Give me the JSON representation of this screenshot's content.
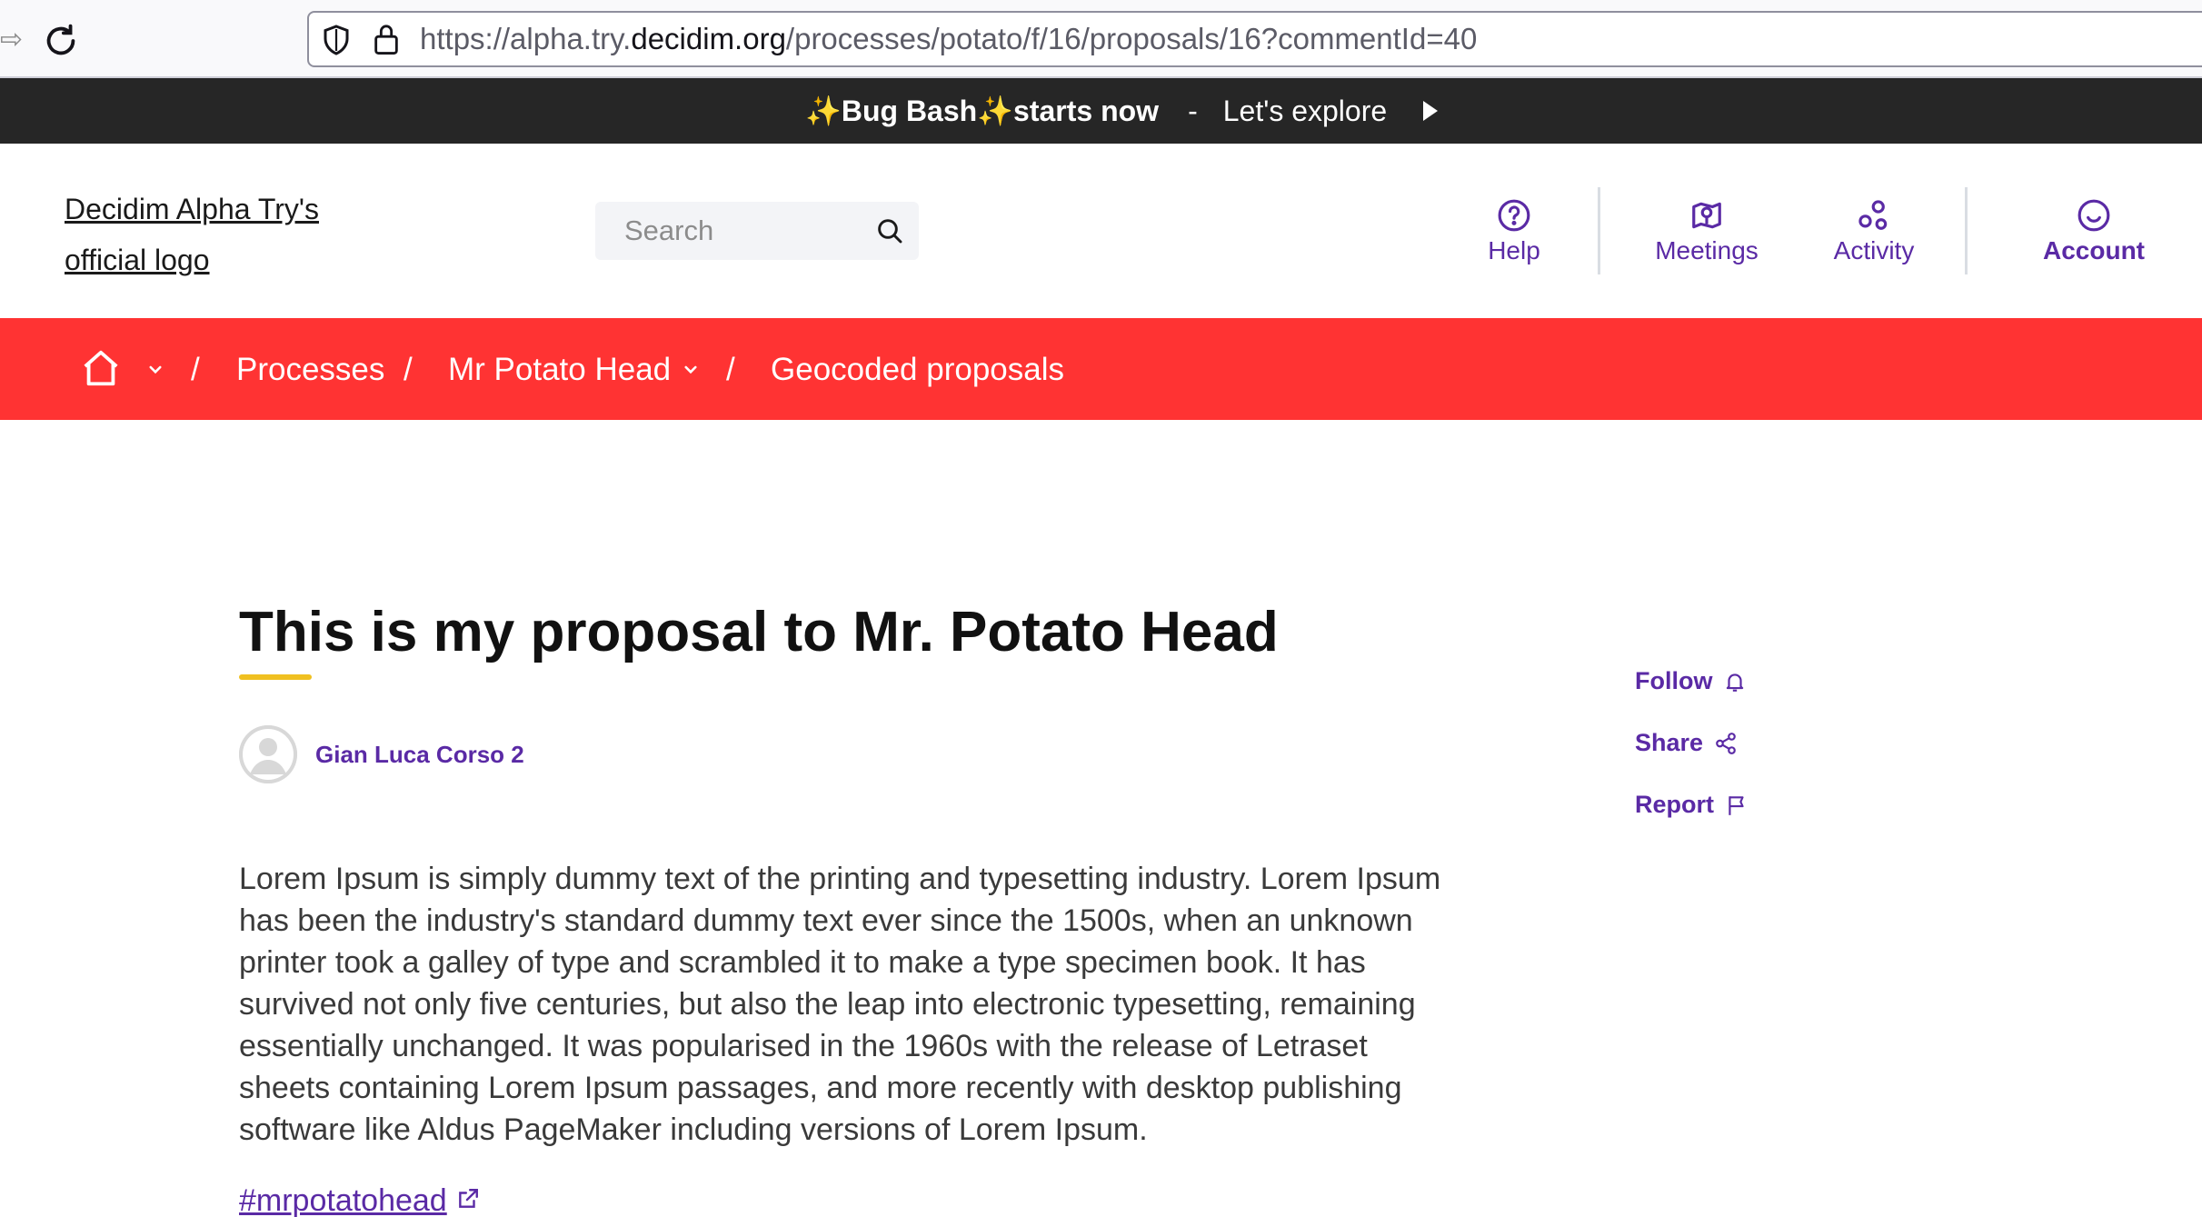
{
  "browser": {
    "url_prefix": "https://alpha.try.",
    "url_host": "decidim.org",
    "url_path": "/processes/potato/f/16/proposals/16?commentId=40",
    "back_glyph": "⇨"
  },
  "announcement": {
    "sparkle": "✨",
    "title_part1": "Bug Bash",
    "title_part2": "starts now",
    "separator": "-",
    "link_label": "Let's explore"
  },
  "header": {
    "logo_label": "Decidim Alpha Try's official logo",
    "search_placeholder": "Search",
    "menu": {
      "help": "Help",
      "meetings": "Meetings",
      "activity": "Activity",
      "account": "Account"
    }
  },
  "breadcrumb": {
    "separator": "/",
    "items": [
      "Processes",
      "Mr Potato Head",
      "Geocoded proposals"
    ]
  },
  "proposal": {
    "title": "This is my proposal to Mr. Potato Head",
    "author": "Gian Luca Corso 2",
    "body": "Lorem Ipsum is simply dummy text of the printing and typesetting industry. Lorem Ipsum has been the industry's standard dummy text ever since the 1500s, when an unknown printer took a galley of type and scrambled it to make a type specimen book. It has survived not only five centuries, but also the leap into electronic typesetting, remaining essentially unchanged. It was popularised in the 1960s with the release of Letraset sheets containing Lorem Ipsum passages, and more recently with desktop publishing software like Aldus PageMaker including versions of Lorem Ipsum.",
    "hashtag": "#mrpotatohead"
  },
  "actions": {
    "follow": "Follow",
    "share": "Share",
    "report": "Report"
  },
  "colors": {
    "brand_primary": "#ff3333",
    "accent_purple": "#5a2aa5",
    "underline_yellow": "#f0c020",
    "announcement_bg": "#262626"
  },
  "icons": [
    "reload-icon",
    "shield-icon",
    "lock-icon",
    "play-icon",
    "search-icon",
    "help-icon",
    "meetings-icon",
    "activity-icon",
    "account-icon",
    "home-icon",
    "chevron-down-icon",
    "bell-icon",
    "share-icon",
    "flag-icon",
    "external-link-icon"
  ]
}
